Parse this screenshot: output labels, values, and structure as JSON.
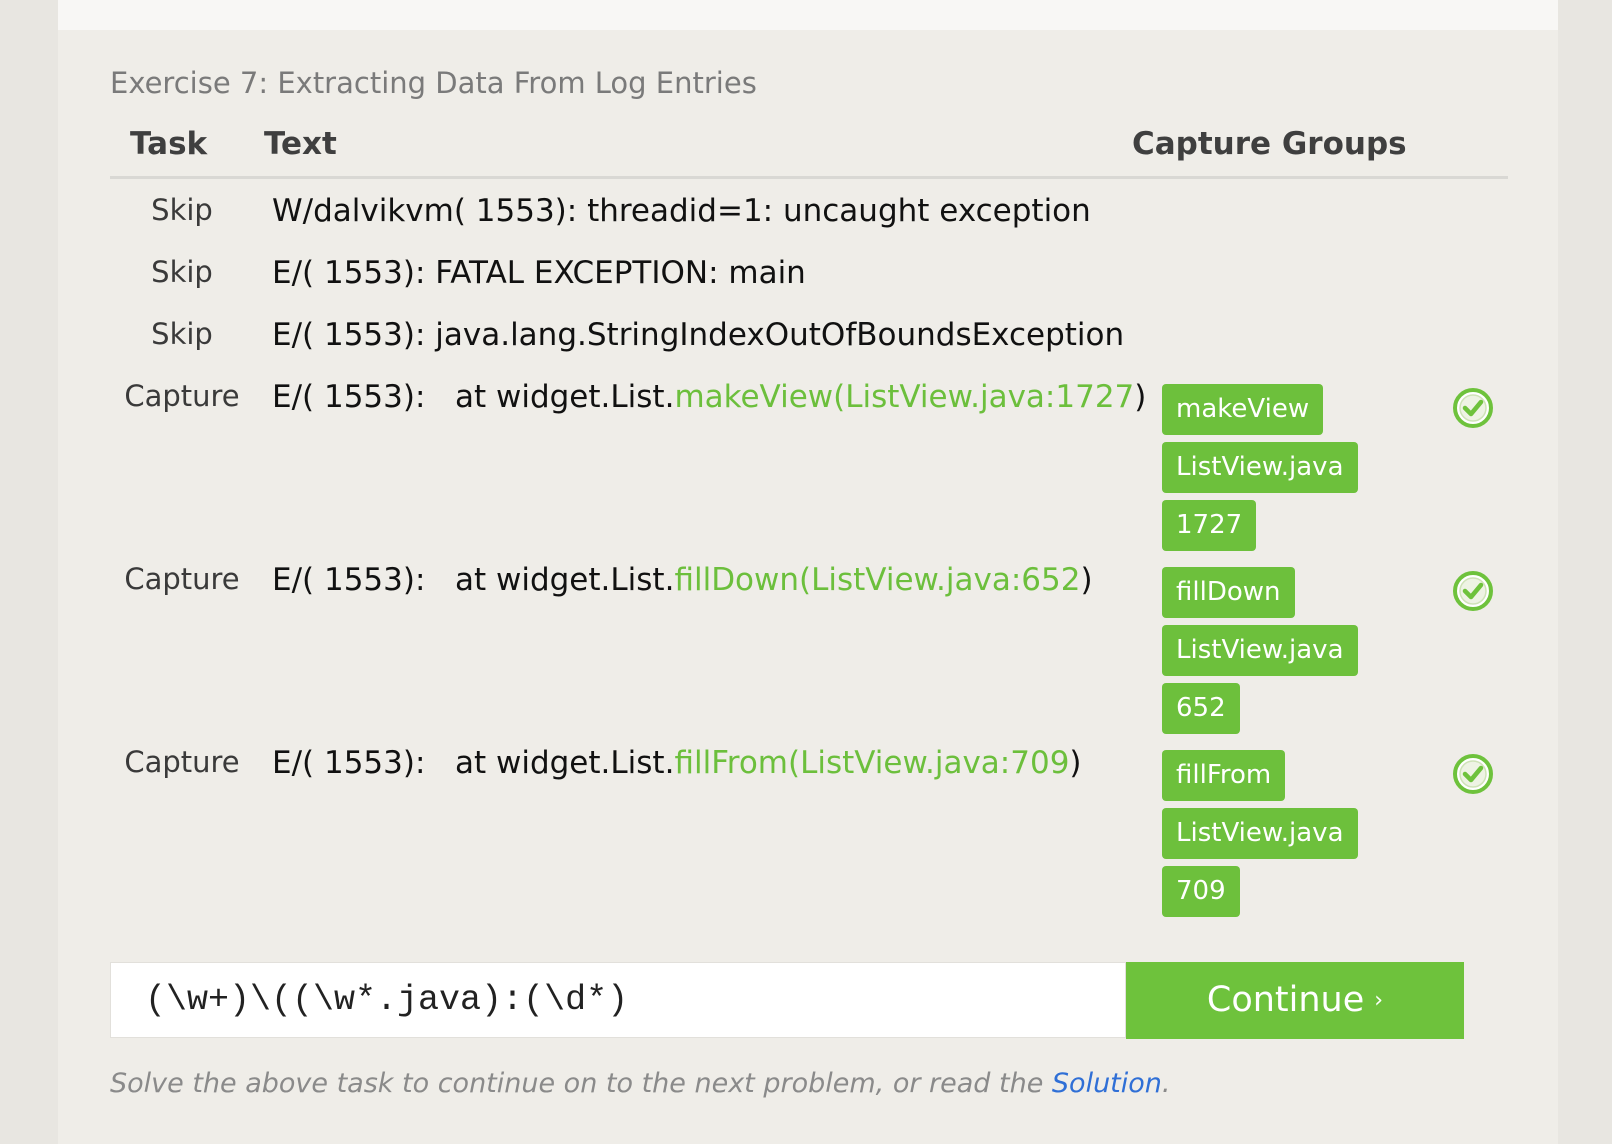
{
  "exercise": {
    "title": "Exercise 7: Extracting Data From Log Entries"
  },
  "table": {
    "headers": {
      "task": "Task",
      "text": "Text",
      "groups": "Capture Groups"
    },
    "rows": [
      {
        "task": "Skip",
        "text_prefix": "W/dalvikvm( 1553): threadid=1: uncaught exception",
        "text_match": "",
        "text_suffix": "",
        "groups": [],
        "matched": false
      },
      {
        "task": "Skip",
        "text_prefix": "E/( 1553): FATAL EXCEPTION: main",
        "text_match": "",
        "text_suffix": "",
        "groups": [],
        "matched": false
      },
      {
        "task": "Skip",
        "text_prefix": "E/( 1553): java.lang.StringIndexOutOfBoundsException",
        "text_match": "",
        "text_suffix": "",
        "groups": [],
        "matched": false
      },
      {
        "task": "Capture",
        "text_prefix": "E/( 1553):   at widget.List.",
        "text_match": "makeView(ListView.java:1727",
        "text_suffix": ")",
        "groups": [
          "makeView",
          "ListView.java",
          "1727"
        ],
        "matched": true
      },
      {
        "task": "Capture",
        "text_prefix": "E/( 1553):   at widget.List.",
        "text_match": "fillDown(ListView.java:652",
        "text_suffix": ")",
        "groups": [
          "fillDown",
          "ListView.java",
          "652"
        ],
        "matched": true
      },
      {
        "task": "Capture",
        "text_prefix": "E/( 1553):   at widget.List.",
        "text_match": "fillFrom(ListView.java:709",
        "text_suffix": ")",
        "groups": [
          "fillFrom",
          "ListView.java",
          "709"
        ],
        "matched": true
      }
    ]
  },
  "input": {
    "value": "(\\w+)\\((\\w*.java):(\\d*)"
  },
  "continue_button": {
    "label": "Continue",
    "chevron": "›"
  },
  "footer": {
    "text": "Solve the above task to continue on to the next problem, or read the ",
    "link": "Solution",
    "end": "."
  },
  "colors": {
    "accent_green": "#6ec23c",
    "match_text_green": "#6cbf3c",
    "link_blue": "#2f6fd6",
    "panel_bg": "#efede8"
  },
  "icons": {
    "match_status": "check-circle-icon",
    "continue": "chevron-right-icon"
  }
}
